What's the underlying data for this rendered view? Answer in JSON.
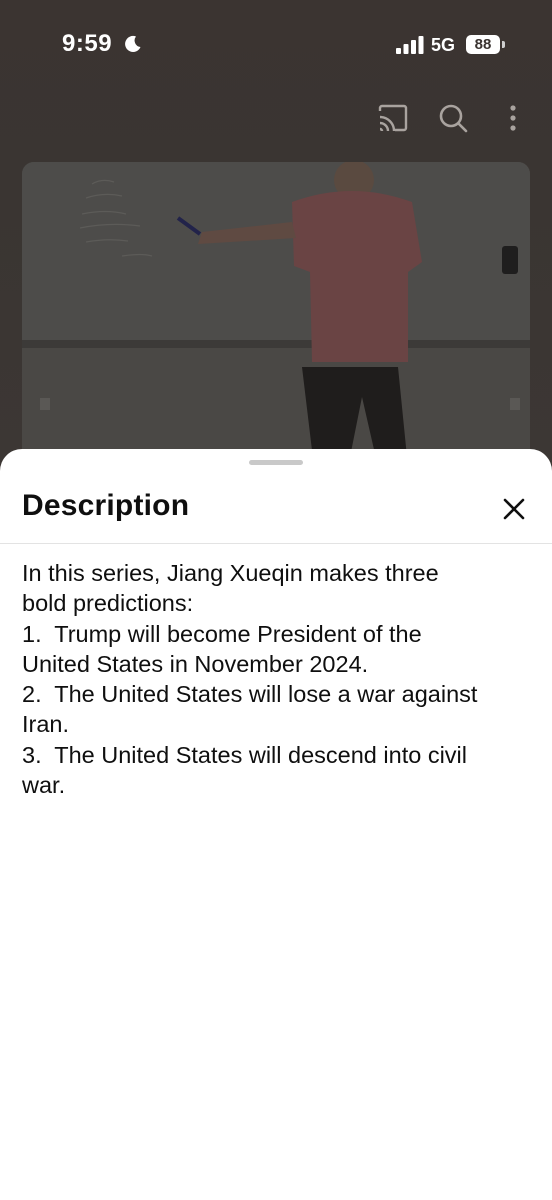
{
  "status_bar": {
    "time": "9:59",
    "network": "5G",
    "battery": "88",
    "icons": [
      "moon-icon",
      "signal-icon",
      "battery-icon"
    ]
  },
  "toolbar": {
    "icons": [
      "cast-icon",
      "search-icon",
      "more-vert-icon"
    ]
  },
  "video": {
    "thumbnail": "lecture-whiteboard-video"
  },
  "description_sheet": {
    "title": "Description",
    "close_icon": "close-icon",
    "lines": [
      "In this series, Jiang Xueqin makes three",
      "bold predictions:",
      "1.  Trump will become President of the",
      "United States in November 2024.",
      "2.  The United States will lose a war against",
      "Iran.",
      "3.  The United States will descend into civil",
      "war."
    ]
  },
  "colors": {
    "dim_background": "#3a3330",
    "sheet_background": "#ffffff",
    "text": "#0f0f0f",
    "grabber": "#c9c9c9"
  }
}
